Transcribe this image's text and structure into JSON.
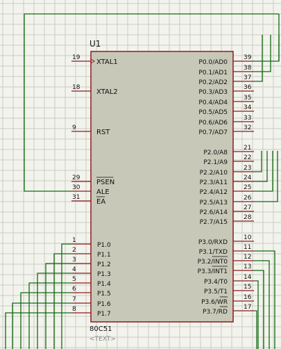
{
  "component": {
    "ref": "U1",
    "part": "80C51",
    "text_placeholder": "<TEXT>"
  },
  "colors": {
    "background": "#f3f3ee",
    "grid": "#c9cbbf",
    "body_fill": "#c8c8b8",
    "body_stroke": "#8b1a1a",
    "pin": "#8b1a1a",
    "wire": "#0f6a0f",
    "text": "#101010",
    "pin_number": "#101010",
    "text_placeholder": "#888888"
  },
  "left_pins": [
    {
      "num": "19",
      "label": "XTAL1"
    },
    {
      "num": "18",
      "label": "XTAL2"
    },
    {
      "num": "9",
      "label": "RST"
    },
    {
      "num": "29",
      "label": "PSEN"
    },
    {
      "num": "30",
      "label": "ALE"
    },
    {
      "num": "31",
      "label": "EA"
    },
    {
      "num": "1",
      "label": "P1.0"
    },
    {
      "num": "2",
      "label": "P1.1"
    },
    {
      "num": "3",
      "label": "P1.2"
    },
    {
      "num": "4",
      "label": "P1.3"
    },
    {
      "num": "5",
      "label": "P1.4"
    },
    {
      "num": "6",
      "label": "P1.5"
    },
    {
      "num": "7",
      "label": "P1.6"
    },
    {
      "num": "8",
      "label": "P1.7"
    }
  ],
  "right_pins": [
    {
      "num": "39",
      "label": "P0.0/AD0"
    },
    {
      "num": "38",
      "label": "P0.1/AD1"
    },
    {
      "num": "37",
      "label": "P0.2/AD2"
    },
    {
      "num": "36",
      "label": "P0.3/AD3"
    },
    {
      "num": "35",
      "label": "P0.4/AD4"
    },
    {
      "num": "34",
      "label": "P0.5/AD5"
    },
    {
      "num": "33",
      "label": "P0.6/AD6"
    },
    {
      "num": "32",
      "label": "P0.7/AD7"
    },
    {
      "num": "21",
      "label": "P2.0/A8"
    },
    {
      "num": "22",
      "label": "P2.1/A9"
    },
    {
      "num": "23",
      "label": "P2.2/A10"
    },
    {
      "num": "24",
      "label": "P2.3/A11"
    },
    {
      "num": "25",
      "label": "P2.4/A12"
    },
    {
      "num": "26",
      "label": "P2.5/A13"
    },
    {
      "num": "27",
      "label": "P2.6/A14"
    },
    {
      "num": "28",
      "label": "P2.7/A15"
    },
    {
      "num": "10",
      "label": "P3.0/RXD"
    },
    {
      "num": "11",
      "label": "P3.1/TXD"
    },
    {
      "num": "12",
      "label": "P3.2/INT0"
    },
    {
      "num": "13",
      "label": "P3.3/INT1"
    },
    {
      "num": "14",
      "label": "P3.4/T0"
    },
    {
      "num": "15",
      "label": "P3.5/T1"
    },
    {
      "num": "16",
      "label": "P3.6/WR"
    },
    {
      "num": "17",
      "label": "P3.7/RD"
    }
  ]
}
